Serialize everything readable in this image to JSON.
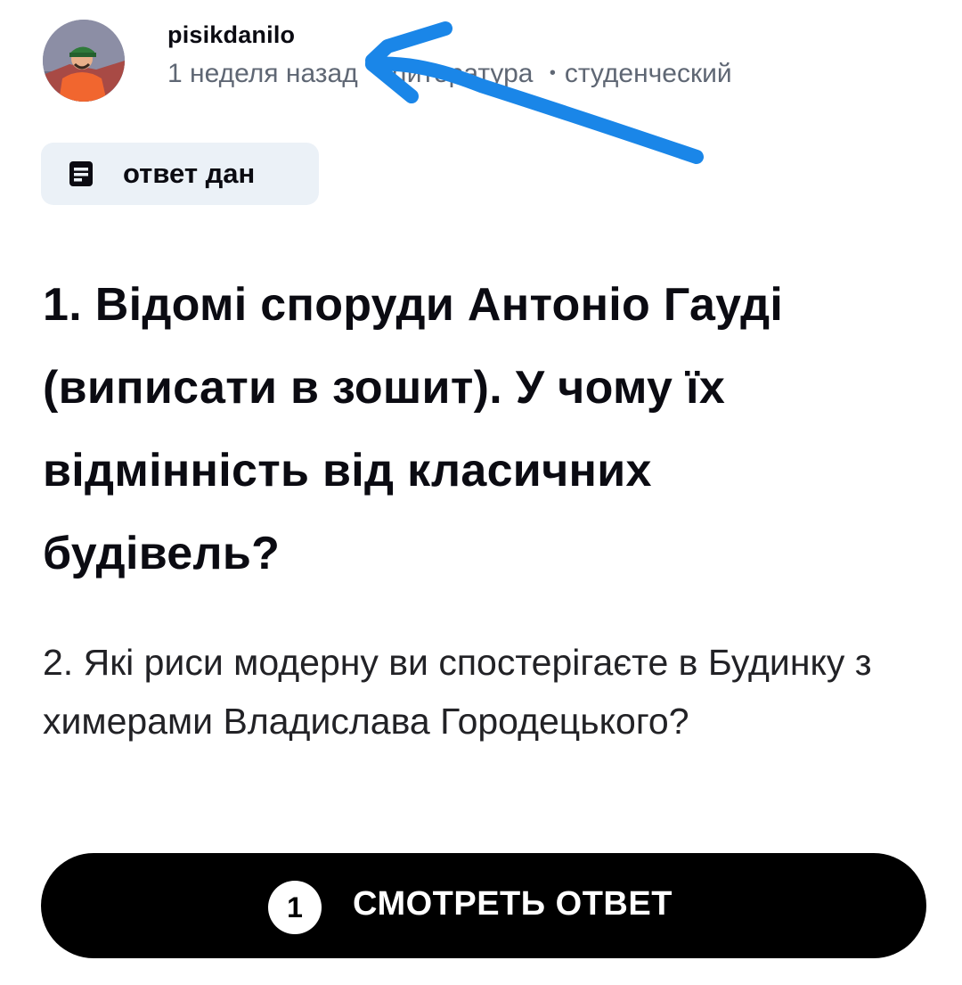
{
  "question": {
    "author": {
      "username": "pisikdanilo",
      "avatar_icon": "user-avatar-icon"
    },
    "meta": {
      "time_ago": "1 неделя назад",
      "subject": "Литература",
      "level": "студенческий",
      "separator": "•"
    },
    "status_badge": {
      "label": "ответ дан",
      "icon": "document-icon"
    },
    "title": "1. Відомі споруди Антоніо Гауді (виписати в зошит). У чому їх відмінність від класичних будівель?",
    "body": "2. Які риси модерну ви спостерігаєте в Будинку з химерами Владислава Городецького?"
  },
  "answer_button": {
    "count": "1",
    "label": "СМОТРЕТЬ ОТВЕТ"
  },
  "colors": {
    "annotation_stroke": "#1a86e8",
    "badge_background": "#ebf1f7",
    "meta_text": "#5f6774",
    "button_background": "#000000"
  }
}
